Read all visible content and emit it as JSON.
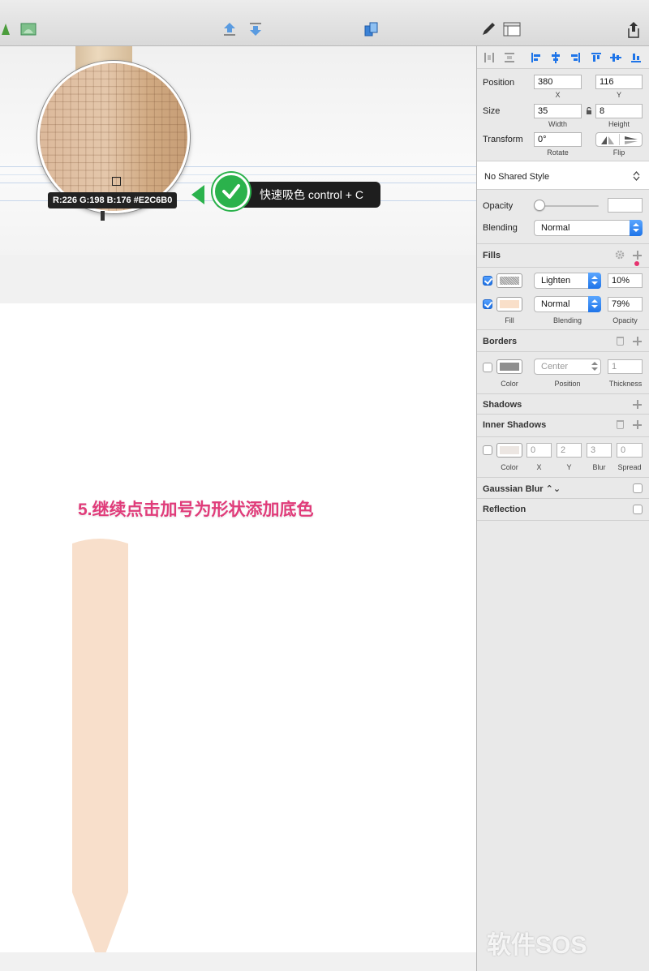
{
  "toolbar": {
    "icons": [
      "tree-icon",
      "mask-shape-icon",
      "forward-icon",
      "backward-icon",
      "mirror-icon",
      "pen-icon",
      "view-icon",
      "export-icon"
    ]
  },
  "canvas": {
    "loupe_readout": "R:226 G:198 B:176 #E2C6B0",
    "callout_text": "快速吸色 control + C",
    "step_note": "5.继续点击加号为形状添加底色",
    "pencil_fill_color": "#F8DFCB"
  },
  "inspector": {
    "position": {
      "label": "Position",
      "x": "380",
      "y": "116",
      "x_label": "X",
      "y_label": "Y"
    },
    "size": {
      "label": "Size",
      "width": "35",
      "height": "8",
      "width_label": "Width",
      "height_label": "Height"
    },
    "transform": {
      "label": "Transform",
      "rotate": "0°",
      "rotate_label": "Rotate",
      "flip_label": "Flip"
    },
    "shared_style": "No Shared Style",
    "opacity": {
      "label": "Opacity",
      "value": ""
    },
    "blending": {
      "label": "Blending",
      "value": "Normal"
    },
    "fills": {
      "title": "Fills",
      "rows": [
        {
          "checked": true,
          "blending": "Lighten",
          "opacity": "10%",
          "swatch": "noise"
        },
        {
          "checked": true,
          "blending": "Normal",
          "opacity": "79%",
          "swatch": "#F9DFC9"
        }
      ],
      "col_fill": "Fill",
      "col_blending": "Blending",
      "col_opacity": "Opacity"
    },
    "borders": {
      "title": "Borders",
      "position": "Center",
      "thickness": "1",
      "col_color": "Color",
      "col_position": "Position",
      "col_thickness": "Thickness"
    },
    "shadows": {
      "title": "Shadows"
    },
    "inner_shadows": {
      "title": "Inner Shadows",
      "x": "0",
      "y": "2",
      "blur": "3",
      "spread": "0",
      "col_color": "Color",
      "col_x": "X",
      "col_y": "Y",
      "col_blur": "Blur",
      "col_spread": "Spread"
    },
    "gaussian_blur": {
      "title": "Gaussian Blur ⌃⌄"
    },
    "reflection": {
      "title": "Reflection"
    }
  },
  "watermark": "软件SOS",
  "colors": {
    "accent": "#1E74E8",
    "callout_green": "#2BB24C",
    "note_pink": "#E03C7A"
  }
}
